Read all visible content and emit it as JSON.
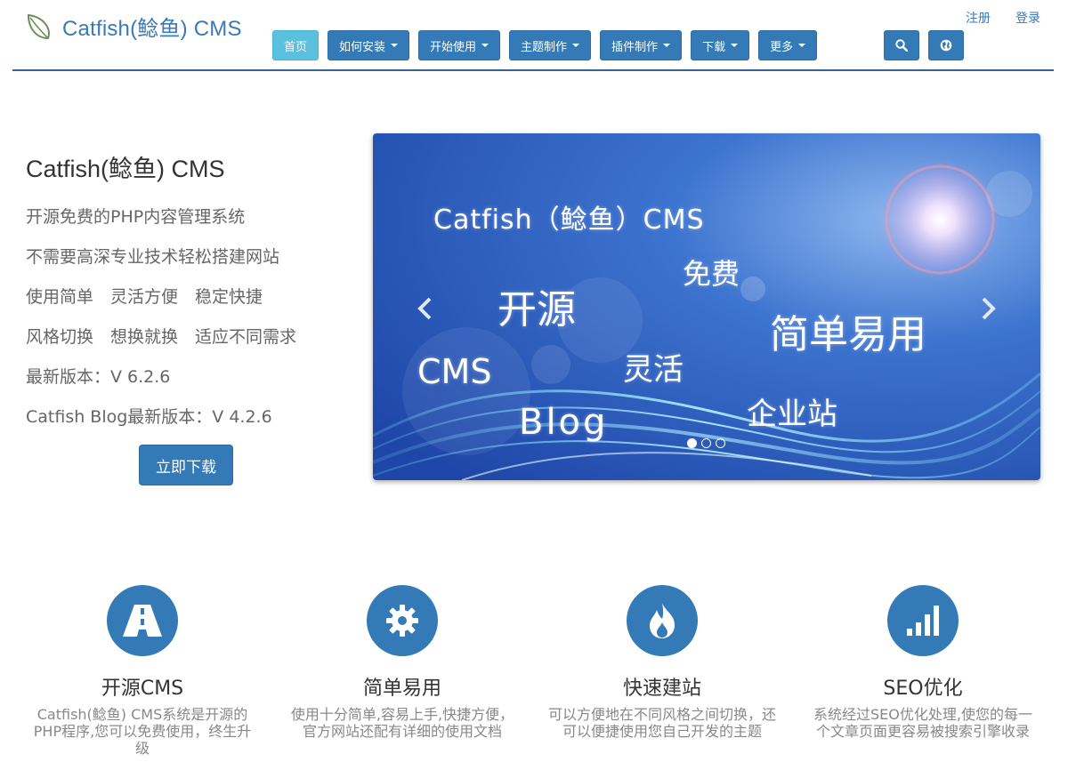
{
  "header": {
    "site_name": "Catfish(鲶鱼) CMS",
    "top_links": {
      "register": "注册",
      "login": "登录"
    },
    "nav": [
      {
        "label": "首页",
        "dropdown": false,
        "active": true
      },
      {
        "label": "如何安装",
        "dropdown": true
      },
      {
        "label": "开始使用",
        "dropdown": true
      },
      {
        "label": "主题制作",
        "dropdown": true
      },
      {
        "label": "插件制作",
        "dropdown": true
      },
      {
        "label": "下载",
        "dropdown": true
      },
      {
        "label": "更多",
        "dropdown": true
      }
    ],
    "icons": [
      "search-icon",
      "globe-icon"
    ],
    "accent_color": "#337ab7",
    "active_color": "#5bc0de"
  },
  "hero": {
    "title": "Catfish(鲶鱼) CMS",
    "lines": [
      "开源免费的PHP内容管理系统",
      "不需要高深专业技术轻松搭建网站",
      "使用简单　灵活方便　稳定快捷",
      "风格切换　想换就换　适应不同需求",
      "最新版本：V 6.2.6",
      "Catfish Blog最新版本：V 4.2.6"
    ],
    "download_label": "立即下载"
  },
  "carousel": {
    "slide_texts": {
      "title": "Catfish（鲶鱼）CMS",
      "free": "免费",
      "open_source": "开源",
      "simple": "简单易用",
      "cms": "CMS",
      "flexible": "灵活",
      "enterprise": "企业站",
      "blog": "Blog"
    },
    "slide_count": 3,
    "active_slide": 1
  },
  "features": [
    {
      "icon": "road-icon",
      "title": "开源CMS",
      "desc": "Catfish(鲶鱼) CMS系统是开源的PHP程序,您可以免费使用，终生升级"
    },
    {
      "icon": "gear-icon",
      "title": "简单易用",
      "desc": "使用十分简单,容易上手,快捷方便，官方网站还配有详细的使用文档"
    },
    {
      "icon": "fire-icon",
      "title": "快速建站",
      "desc": "可以方便地在不同风格之间切换，还可以便捷使用您自己开发的主题"
    },
    {
      "icon": "signal-icon",
      "title": "SEO优化",
      "desc": "系统经过SEO优化处理,使您的每一个文章页面更容易被搜索引擎收录"
    }
  ]
}
